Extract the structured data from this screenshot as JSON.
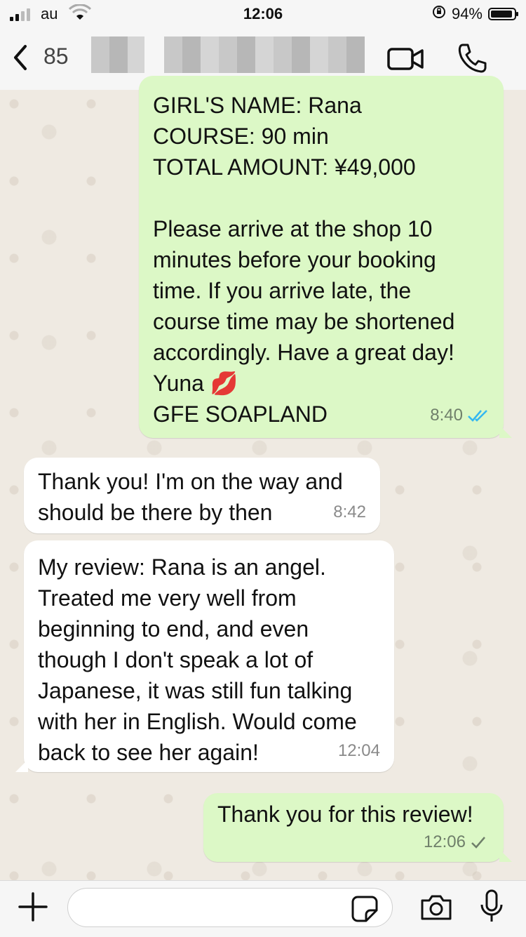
{
  "status_bar": {
    "carrier": "au",
    "time": "12:06",
    "battery_text": "94%",
    "battery_level": 0.94
  },
  "header": {
    "contact_visible": "85"
  },
  "messages": [
    {
      "direction": "out",
      "text": "GIRL'S NAME: Rana\nCOURSE: 90 min\nTOTAL AMOUNT: ¥49,000\n\nPlease arrive at the shop 10\nminutes before your booking\ntime. If you arrive late, the\ncourse time may be shortened\naccordingly. Have a great day!\nYuna 💋\nGFE SOAPLAND",
      "time": "8:40",
      "receipt": "read"
    },
    {
      "direction": "in",
      "text": "Thank you! I'm on the way and\nshould be there by then",
      "time": "8:42"
    },
    {
      "direction": "in",
      "text": "My review: Rana is an angel.\nTreated me very well from\nbeginning to end, and even\nthough I don't speak a lot of\nJapanese, it was still fun talking\nwith her in English. Would come\nback to see her again!",
      "time": "12:04"
    },
    {
      "direction": "out",
      "text": "Thank you for this review!",
      "time": "12:06",
      "receipt": "sent"
    }
  ],
  "input": {
    "value": "",
    "placeholder": ""
  },
  "colors": {
    "outgoing_bubble": "#dcf8c6",
    "incoming_bubble": "#ffffff",
    "read_tick": "#34b7f1",
    "sent_tick": "#6f7f6a"
  }
}
